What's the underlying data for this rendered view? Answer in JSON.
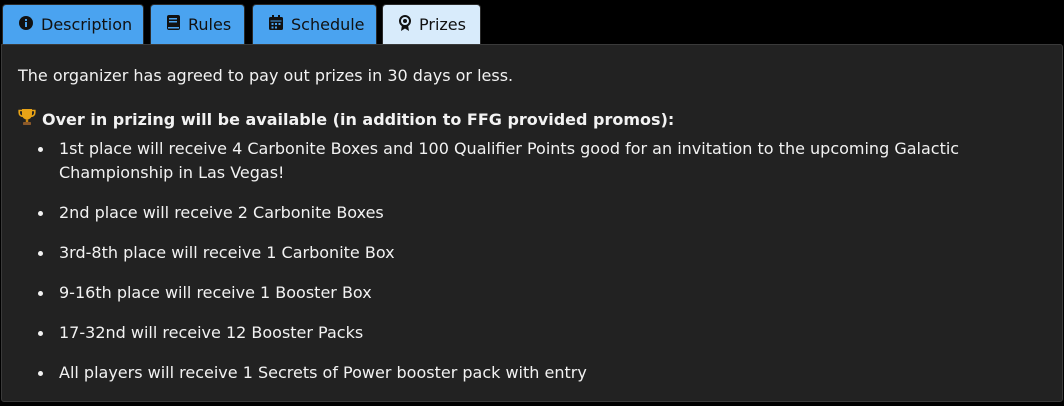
{
  "tabs": [
    {
      "label": "Description",
      "icon": "info-circle-icon"
    },
    {
      "label": "Rules",
      "icon": "book-icon"
    },
    {
      "label": "Schedule",
      "icon": "calendar-icon"
    },
    {
      "label": "Prizes",
      "icon": "award-ribbon-icon",
      "active": true
    }
  ],
  "panel": {
    "intro": "The organizer has agreed to pay out prizes in 30 days or less.",
    "heading_icon": "trophy-icon",
    "heading": "Over in prizing will be available (in addition to FFG provided promos):",
    "prizes": [
      "1st place will receive 4 Carbonite Boxes and 100 Qualifier Points good for an invitation to the upcoming Galactic Championship in Las Vegas!",
      "2nd place will receive 2 Carbonite Boxes",
      "3rd-8th place will receive 1 Carbonite Box",
      "9-16th place will receive 1 Booster Box",
      "17-32nd will receive 12 Booster Packs",
      "All players will receive 1 Secrets of Power booster pack with entry"
    ]
  },
  "colors": {
    "tab_background": "#4aa3f0",
    "tab_active_background": "#d8ebfb",
    "panel_background": "#222222",
    "page_background": "#000000"
  }
}
